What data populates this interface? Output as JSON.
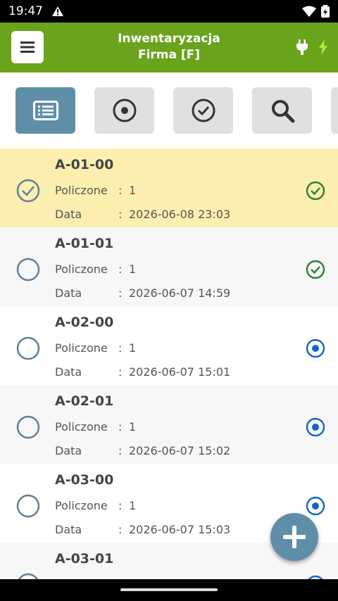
{
  "status_bar": {
    "time": "19:47",
    "alert_symbol": "!"
  },
  "app_bar": {
    "title": "Inwentaryzacja",
    "subtitle": "Firma [F]"
  },
  "toolbar": {
    "buttons": [
      {
        "icon": "list-icon",
        "active": true
      },
      {
        "icon": "radio-icon",
        "active": false
      },
      {
        "icon": "check-circle-icon",
        "active": false
      },
      {
        "icon": "search-icon",
        "active": false
      }
    ]
  },
  "list": {
    "count_label": "Policzone",
    "date_label": "Data",
    "colon": ":",
    "items": [
      {
        "name": "A-01-00",
        "count": "1",
        "date": "2026-06-08 23:03",
        "selected": true,
        "status": "done"
      },
      {
        "name": "A-01-01",
        "count": "1",
        "date": "2026-06-07 14:59",
        "selected": false,
        "status": "done"
      },
      {
        "name": "A-02-00",
        "count": "1",
        "date": "2026-06-07 15:01",
        "selected": false,
        "status": "open"
      },
      {
        "name": "A-02-01",
        "count": "1",
        "date": "2026-06-07 15:02",
        "selected": false,
        "status": "open"
      },
      {
        "name": "A-03-00",
        "count": "1",
        "date": "2026-06-07 15:03",
        "selected": false,
        "status": "open"
      },
      {
        "name": "A-03-01",
        "count": "",
        "date": "",
        "selected": false,
        "status": "open"
      }
    ]
  },
  "colors": {
    "appbar": "#6aa31c",
    "accent": "#5f8fa8",
    "done": "#2e7d32",
    "open": "#1565c0",
    "selected_row": "#fcefb0"
  }
}
